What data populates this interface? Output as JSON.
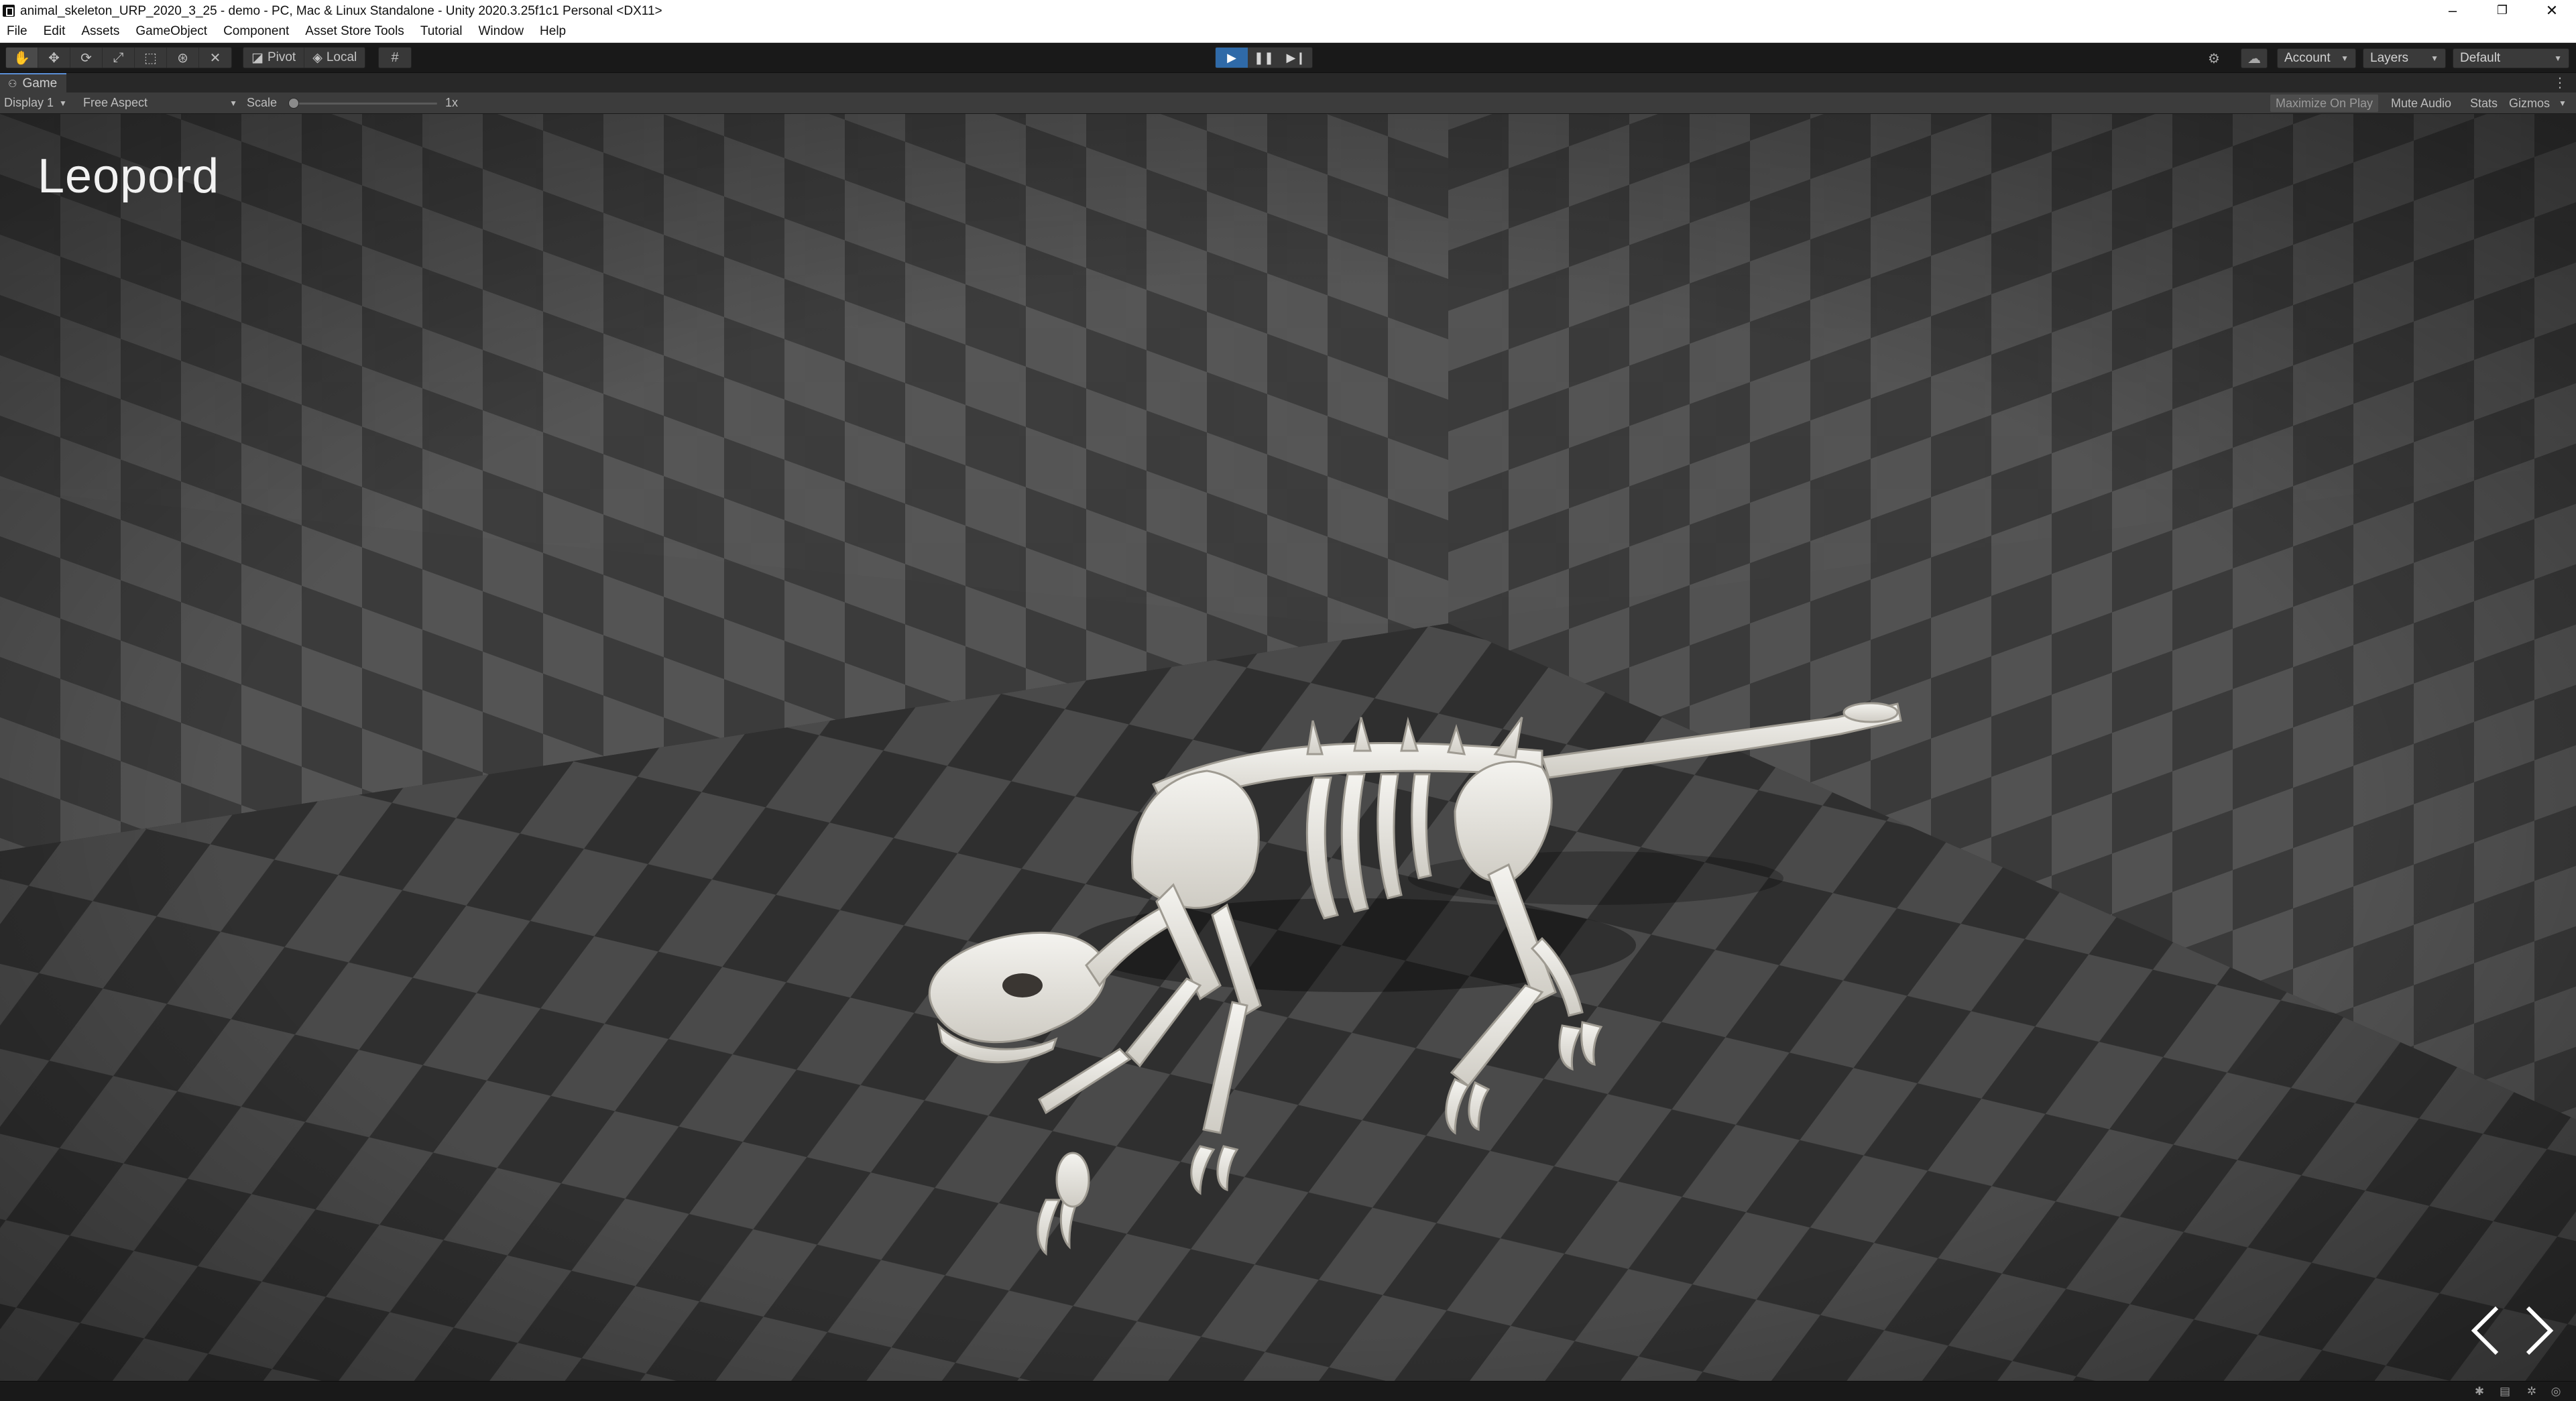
{
  "window": {
    "title": "animal_skeleton_URP_2020_3_25 - demo - PC, Mac & Linux Standalone - Unity 2020.3.25f1c1 Personal <DX11>",
    "minimize_glyph": "–",
    "restore_glyph": "❐",
    "close_glyph": "✕"
  },
  "menu": [
    "File",
    "Edit",
    "Assets",
    "GameObject",
    "Component",
    "Asset Store Tools",
    "Tutorial",
    "Window",
    "Help"
  ],
  "toolbar": {
    "transform_tools": [
      "hand-tool-icon",
      "move-tool-icon",
      "rotate-tool-icon",
      "scale-tool-icon",
      "rect-tool-icon",
      "transform-tool-icon",
      "custom-tool-icon"
    ],
    "pivot_label": "Pivot",
    "local_label": "Local",
    "play_state": "playing",
    "account_label": "Account",
    "layers_label": "Layers",
    "layout_label": "Default"
  },
  "game_tab": {
    "label": "Game"
  },
  "game_view": {
    "display_label": "Display 1",
    "aspect_label": "Free Aspect",
    "scale_label": "Scale",
    "scale_value": "1x",
    "maximize_label": "Maximize On Play",
    "mute_label": "Mute Audio",
    "stats_label": "Stats",
    "gizmos_label": "Gizmos"
  },
  "scene": {
    "animal_name": "Leopord",
    "prev_glyph": "<",
    "next_glyph": ">"
  },
  "colors": {
    "play_active": "#2f6aa8",
    "checker_light": "#5a5a5a",
    "checker_dark": "#3a3a3a",
    "bone": "#e8e6e1"
  }
}
